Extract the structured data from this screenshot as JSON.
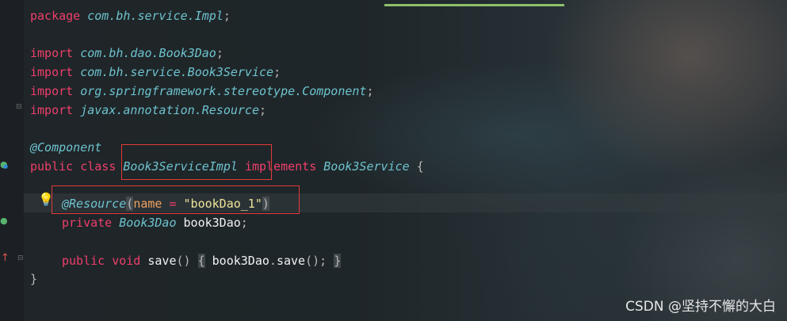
{
  "editor": {
    "lines": {
      "package": {
        "kw": "package",
        "name": "com.bh.service.Impl",
        "semi": ";"
      },
      "import1": {
        "kw": "import",
        "name": "com.bh.dao.Book3Dao",
        "semi": ";"
      },
      "import2": {
        "kw": "import",
        "name": "com.bh.service.Book3Service",
        "semi": ";"
      },
      "import3": {
        "kw": "import",
        "name": "org.springframework.stereotype.Component",
        "semi": ";"
      },
      "import4": {
        "kw": "import",
        "name": "javax.annotation.Resource",
        "semi": ";"
      },
      "annotation_component": "@Component",
      "class_decl": {
        "kw_public": "public",
        "kw_class": "class",
        "class_name": "Book3ServiceImpl",
        "kw_implements": "implements",
        "interface_name": "Book3Service",
        "brace": "{"
      },
      "resource": {
        "annotation": "@Resource",
        "open": "(",
        "param": "name",
        "eq": "=",
        "value": "\"bookDao_1\"",
        "close": ")"
      },
      "field": {
        "kw": "private",
        "type": "Book3Dao",
        "name": "book3Dao",
        "semi": ";"
      },
      "save": {
        "kw_public": "public",
        "kw_void": "void",
        "method": "save",
        "parens": "()",
        "open_brace": "{",
        "target": "book3Dao",
        "dot": ".",
        "call": "save",
        "call_parens": "();",
        "close_brace": "}"
      },
      "class_end": "}"
    },
    "icons": [
      "implementation-icon",
      "bulb-icon",
      "injected-field-icon",
      "override-arrow-icon",
      "fold-icon"
    ]
  },
  "watermark": "CSDN @坚持不懈的大白"
}
